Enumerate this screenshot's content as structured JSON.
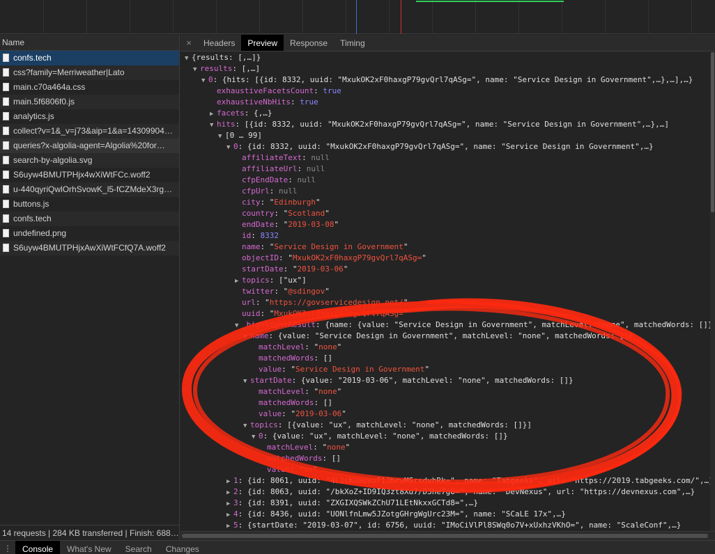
{
  "left": {
    "header": "Name",
    "requests": [
      {
        "name": "confs.tech",
        "state": "selected"
      },
      {
        "name": "css?family=Merriweather|Lato",
        "state": ""
      },
      {
        "name": "main.c70a464a.css",
        "state": ""
      },
      {
        "name": "main.5f6806f0.js",
        "state": ""
      },
      {
        "name": "analytics.js",
        "state": ""
      },
      {
        "name": "collect?v=1&_v=j73&aip=1&a=14309904…",
        "state": ""
      },
      {
        "name": "queries?x-algolia-agent=Algolia%20for…",
        "state": "hovered"
      },
      {
        "name": "search-by-algolia.svg",
        "state": ""
      },
      {
        "name": "S6uyw4BMUTPHjx4wXiWtFCc.woff2",
        "state": ""
      },
      {
        "name": "u-440qyriQwlOrhSvowK_l5-fCZMdeX3rg…",
        "state": ""
      },
      {
        "name": "buttons.js",
        "state": ""
      },
      {
        "name": "confs.tech",
        "state": ""
      },
      {
        "name": "undefined.png",
        "state": ""
      },
      {
        "name": "S6uyw4BMUTPHjxAwXiWtFCfQ7A.woff2",
        "state": ""
      }
    ],
    "footer": "14 requests | 284 KB transferred | Finish: 688…"
  },
  "tabs": {
    "close": "×",
    "items": [
      {
        "label": "Headers",
        "active": false
      },
      {
        "label": "Preview",
        "active": true
      },
      {
        "label": "Response",
        "active": false
      },
      {
        "label": "Timing",
        "active": false
      }
    ]
  },
  "tree": [
    {
      "indent": 0,
      "arrow": "down",
      "tokens": [
        {
          "c": "o",
          "t": "{results: [,…]}"
        }
      ]
    },
    {
      "indent": 1,
      "arrow": "down",
      "tokens": [
        {
          "c": "k",
          "t": "results"
        },
        {
          "c": "o",
          "t": ": [,…]"
        }
      ]
    },
    {
      "indent": 2,
      "arrow": "down",
      "tokens": [
        {
          "c": "k",
          "t": "0"
        },
        {
          "c": "o",
          "t": ": {hits: [{id: 8332, uuid: \"MxukOK2xF0haxgP79gvQrl7qASg=\", name: \"Service Design in Government\",…},…],…}"
        }
      ]
    },
    {
      "indent": 3,
      "arrow": "",
      "tokens": [
        {
          "c": "k",
          "t": "exhaustiveFacetsCount"
        },
        {
          "c": "o",
          "t": ": "
        },
        {
          "c": "b",
          "t": "true"
        }
      ]
    },
    {
      "indent": 3,
      "arrow": "",
      "tokens": [
        {
          "c": "k",
          "t": "exhaustiveNbHits"
        },
        {
          "c": "o",
          "t": ": "
        },
        {
          "c": "b",
          "t": "true"
        }
      ]
    },
    {
      "indent": 3,
      "arrow": "right",
      "tokens": [
        {
          "c": "k",
          "t": "facets"
        },
        {
          "c": "o",
          "t": ": {,…}"
        }
      ]
    },
    {
      "indent": 3,
      "arrow": "down",
      "tokens": [
        {
          "c": "k",
          "t": "hits"
        },
        {
          "c": "o",
          "t": ": [{id: 8332, uuid: \"MxukOK2xF0haxgP79gvQrl7qASg=\", name: \"Service Design in Government\",…},…]"
        }
      ]
    },
    {
      "indent": 4,
      "arrow": "down",
      "tokens": [
        {
          "c": "o",
          "t": "[0 … 99]"
        }
      ]
    },
    {
      "indent": 5,
      "arrow": "down",
      "tokens": [
        {
          "c": "k",
          "t": "0"
        },
        {
          "c": "o",
          "t": ": {id: 8332, uuid: \"MxukOK2xF0haxgP79gvQrl7qASg=\", name: \"Service Design in Government\",…}"
        }
      ]
    },
    {
      "indent": 6,
      "arrow": "",
      "tokens": [
        {
          "c": "k",
          "t": "affiliateText"
        },
        {
          "c": "o",
          "t": ": "
        },
        {
          "c": "nl",
          "t": "null"
        }
      ]
    },
    {
      "indent": 6,
      "arrow": "",
      "tokens": [
        {
          "c": "k",
          "t": "affiliateUrl"
        },
        {
          "c": "o",
          "t": ": "
        },
        {
          "c": "nl",
          "t": "null"
        }
      ]
    },
    {
      "indent": 6,
      "arrow": "",
      "tokens": [
        {
          "c": "k",
          "t": "cfpEndDate"
        },
        {
          "c": "o",
          "t": ": "
        },
        {
          "c": "nl",
          "t": "null"
        }
      ]
    },
    {
      "indent": 6,
      "arrow": "",
      "tokens": [
        {
          "c": "k",
          "t": "cfpUrl"
        },
        {
          "c": "o",
          "t": ": "
        },
        {
          "c": "nl",
          "t": "null"
        }
      ]
    },
    {
      "indent": 6,
      "arrow": "",
      "tokens": [
        {
          "c": "k",
          "t": "city"
        },
        {
          "c": "o",
          "t": ": \""
        },
        {
          "c": "s",
          "t": "Edinburgh"
        },
        {
          "c": "o",
          "t": "\""
        }
      ]
    },
    {
      "indent": 6,
      "arrow": "",
      "tokens": [
        {
          "c": "k",
          "t": "country"
        },
        {
          "c": "o",
          "t": ": \""
        },
        {
          "c": "s",
          "t": "Scotland"
        },
        {
          "c": "o",
          "t": "\""
        }
      ]
    },
    {
      "indent": 6,
      "arrow": "",
      "tokens": [
        {
          "c": "k",
          "t": "endDate"
        },
        {
          "c": "o",
          "t": ": \""
        },
        {
          "c": "s",
          "t": "2019-03-08"
        },
        {
          "c": "o",
          "t": "\""
        }
      ]
    },
    {
      "indent": 6,
      "arrow": "",
      "tokens": [
        {
          "c": "k",
          "t": "id"
        },
        {
          "c": "o",
          "t": ": "
        },
        {
          "c": "n",
          "t": "8332"
        }
      ]
    },
    {
      "indent": 6,
      "arrow": "",
      "tokens": [
        {
          "c": "k",
          "t": "name"
        },
        {
          "c": "o",
          "t": ": \""
        },
        {
          "c": "s",
          "t": "Service Design in Government"
        },
        {
          "c": "o",
          "t": "\""
        }
      ]
    },
    {
      "indent": 6,
      "arrow": "",
      "tokens": [
        {
          "c": "k",
          "t": "objectID"
        },
        {
          "c": "o",
          "t": ": \""
        },
        {
          "c": "s",
          "t": "MxukOK2xF0haxgP79gvQrl7qASg="
        },
        {
          "c": "o",
          "t": "\""
        }
      ]
    },
    {
      "indent": 6,
      "arrow": "",
      "tokens": [
        {
          "c": "k",
          "t": "startDate"
        },
        {
          "c": "o",
          "t": ": \""
        },
        {
          "c": "s",
          "t": "2019-03-06"
        },
        {
          "c": "o",
          "t": "\""
        }
      ]
    },
    {
      "indent": 6,
      "arrow": "right",
      "tokens": [
        {
          "c": "k",
          "t": "topics"
        },
        {
          "c": "o",
          "t": ": [\"ux\"]"
        }
      ]
    },
    {
      "indent": 6,
      "arrow": "",
      "tokens": [
        {
          "c": "k",
          "t": "twitter"
        },
        {
          "c": "o",
          "t": ": \""
        },
        {
          "c": "s",
          "t": "@sdingov"
        },
        {
          "c": "o",
          "t": "\""
        }
      ]
    },
    {
      "indent": 6,
      "arrow": "",
      "tokens": [
        {
          "c": "k",
          "t": "url"
        },
        {
          "c": "o",
          "t": ": \""
        },
        {
          "c": "s",
          "t": "https://govservicedesign.net/"
        },
        {
          "c": "o",
          "t": "\""
        }
      ]
    },
    {
      "indent": 6,
      "arrow": "",
      "tokens": [
        {
          "c": "k",
          "t": "uuid"
        },
        {
          "c": "o",
          "t": ": \""
        },
        {
          "c": "s",
          "t": "MxukOK2xF0haxgP79gvQrl7qASg="
        },
        {
          "c": "o",
          "t": "\""
        }
      ]
    },
    {
      "indent": 6,
      "arrow": "down",
      "tokens": [
        {
          "c": "k",
          "t": "_highlightResult"
        },
        {
          "c": "o",
          "t": ": {name: {value: \"Service Design in Government\", matchLevel: \"none\", matchedWords: []},…}"
        }
      ]
    },
    {
      "indent": 7,
      "arrow": "down",
      "tokens": [
        {
          "c": "k",
          "t": "name"
        },
        {
          "c": "o",
          "t": ": {value: \"Service Design in Government\", matchLevel: \"none\", matchedWords: []}"
        }
      ]
    },
    {
      "indent": 8,
      "arrow": "",
      "tokens": [
        {
          "c": "k",
          "t": "matchLevel"
        },
        {
          "c": "o",
          "t": ": \""
        },
        {
          "c": "s",
          "t": "none"
        },
        {
          "c": "o",
          "t": "\""
        }
      ]
    },
    {
      "indent": 8,
      "arrow": "",
      "tokens": [
        {
          "c": "k",
          "t": "matchedWords"
        },
        {
          "c": "o",
          "t": ": []"
        }
      ]
    },
    {
      "indent": 8,
      "arrow": "",
      "tokens": [
        {
          "c": "k",
          "t": "value"
        },
        {
          "c": "o",
          "t": ": \""
        },
        {
          "c": "s",
          "t": "Service Design in Government"
        },
        {
          "c": "o",
          "t": "\""
        }
      ]
    },
    {
      "indent": 7,
      "arrow": "down",
      "tokens": [
        {
          "c": "k",
          "t": "startDate"
        },
        {
          "c": "o",
          "t": ": {value: \"2019-03-06\", matchLevel: \"none\", matchedWords: []}"
        }
      ]
    },
    {
      "indent": 8,
      "arrow": "",
      "tokens": [
        {
          "c": "k",
          "t": "matchLevel"
        },
        {
          "c": "o",
          "t": ": \""
        },
        {
          "c": "s",
          "t": "none"
        },
        {
          "c": "o",
          "t": "\""
        }
      ]
    },
    {
      "indent": 8,
      "arrow": "",
      "tokens": [
        {
          "c": "k",
          "t": "matchedWords"
        },
        {
          "c": "o",
          "t": ": []"
        }
      ]
    },
    {
      "indent": 8,
      "arrow": "",
      "tokens": [
        {
          "c": "k",
          "t": "value"
        },
        {
          "c": "o",
          "t": ": \""
        },
        {
          "c": "s",
          "t": "2019-03-06"
        },
        {
          "c": "o",
          "t": "\""
        }
      ]
    },
    {
      "indent": 7,
      "arrow": "down",
      "tokens": [
        {
          "c": "k",
          "t": "topics"
        },
        {
          "c": "o",
          "t": ": [{value: \"ux\", matchLevel: \"none\", matchedWords: []}]"
        }
      ]
    },
    {
      "indent": 8,
      "arrow": "down",
      "tokens": [
        {
          "c": "k",
          "t": "0"
        },
        {
          "c": "o",
          "t": ": {value: \"ux\", matchLevel: \"none\", matchedWords: []}"
        }
      ]
    },
    {
      "indent": 9,
      "arrow": "",
      "tokens": [
        {
          "c": "k",
          "t": "matchLevel"
        },
        {
          "c": "o",
          "t": ": \""
        },
        {
          "c": "s",
          "t": "none"
        },
        {
          "c": "o",
          "t": "\""
        }
      ]
    },
    {
      "indent": 9,
      "arrow": "",
      "tokens": [
        {
          "c": "k",
          "t": "matchedWords"
        },
        {
          "c": "o",
          "t": ": []"
        }
      ]
    },
    {
      "indent": 9,
      "arrow": "",
      "tokens": [
        {
          "c": "k",
          "t": "value"
        },
        {
          "c": "o",
          "t": ": \""
        },
        {
          "c": "s",
          "t": "ux"
        },
        {
          "c": "o",
          "t": "\""
        }
      ]
    },
    {
      "indent": 5,
      "arrow": "right",
      "tokens": [
        {
          "c": "k",
          "t": "1"
        },
        {
          "c": "o",
          "t": ": {id: 8061, uuid: \"4L1sKUaUxoF13brwMSrsdvhRk=\", name: \"Tabgeeks\", url: \"https://2019.tabgeeks.com/\",…}"
        }
      ]
    },
    {
      "indent": 5,
      "arrow": "right",
      "tokens": [
        {
          "c": "k",
          "t": "2"
        },
        {
          "c": "o",
          "t": ": {id: 8063, uuid: \"/bkXoZ+ID9IQ3zt8Xd7/D3he7gU=\", name: \"DevNexus\", url: \"https://devnexus.com\",…}"
        }
      ]
    },
    {
      "indent": 5,
      "arrow": "right",
      "tokens": [
        {
          "c": "k",
          "t": "3"
        },
        {
          "c": "o",
          "t": ": {id: 8391, uuid: \"ZXGIXQSWkZChU71LEtNkxxGCTd8=\",…}"
        }
      ]
    },
    {
      "indent": 5,
      "arrow": "right",
      "tokens": [
        {
          "c": "k",
          "t": "4"
        },
        {
          "c": "o",
          "t": ": {id: 8436, uuid: \"UONlfnLmw5JZotgGHrgWgUrc23M=\", name: \"SCaLE 17x\",…}"
        }
      ]
    },
    {
      "indent": 5,
      "arrow": "right",
      "tokens": [
        {
          "c": "k",
          "t": "5"
        },
        {
          "c": "o",
          "t": ": {startDate: \"2019-03-07\", id: 6756, uuid: \"IMoCiVlPl8SWq0o7V+xUxhzVKhO=\", name: \"ScaleConf\",…}"
        }
      ]
    }
  ],
  "drawer": {
    "tabs": [
      {
        "label": "Console",
        "active": true
      },
      {
        "label": "What's New",
        "active": false
      },
      {
        "label": "Search",
        "active": false
      },
      {
        "label": "Changes",
        "active": false
      }
    ]
  },
  "colors": {
    "annotation": "#ff2a10",
    "selected_row": "#1a3f63",
    "key": "#d46ad1",
    "string": "#f0533f",
    "number": "#8a87ff"
  }
}
